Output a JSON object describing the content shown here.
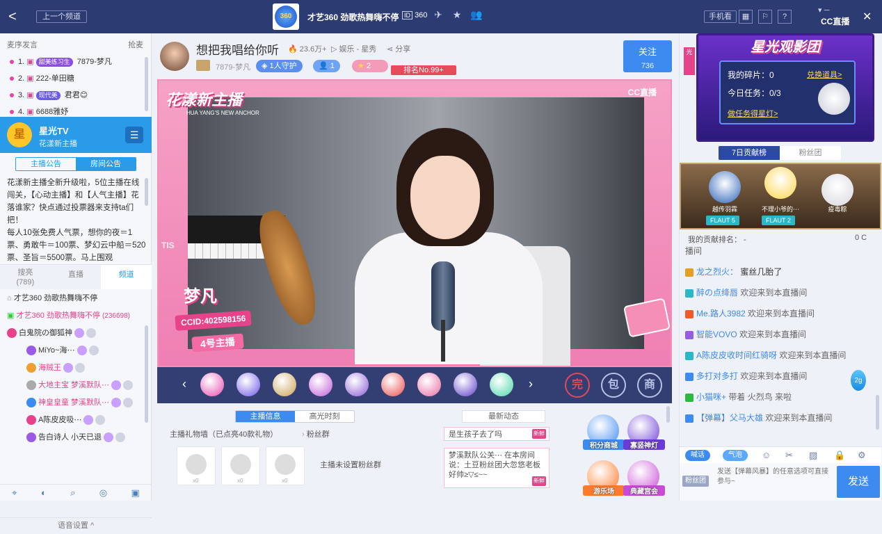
{
  "topbar": {
    "back": "<",
    "prev_channel": "上一个频道",
    "channel_logo": "360",
    "channel_title": "才艺360 劲歌热舞嗨不停",
    "channel_id_icon": "ID",
    "channel_id": "360",
    "phone_watch": "手机看",
    "cc_brand": "CC直播",
    "close": "✕"
  },
  "left": {
    "queue_header": "麦序发言",
    "grab_mic": "抢麦",
    "queue": [
      {
        "rank": "1.",
        "level": "甜美练习生",
        "level_color": "#8a4de6",
        "name": "7879-梦凡"
      },
      {
        "rank": "2.",
        "level": "",
        "level_color": "",
        "name": "222-单田糖"
      },
      {
        "rank": "3.",
        "level": "现代美",
        "level_color": "#6a5ae8",
        "name": "君君😊"
      },
      {
        "rank": "4.",
        "level": "",
        "level_color": "",
        "name": "6688雅妤"
      }
    ],
    "star_tv": {
      "icon": "星",
      "name": "星光TV",
      "sub": "花漾新主播"
    },
    "tabs": [
      "主播公告",
      "房间公告"
    ],
    "notice": "花漾新主播全新升级啦，5位主播在线闯关，【心动主播】和【人气主播】花落谁家？快点通过投票器来支持ta们把！\n每人10张免费人气票，想你的夜＝1票、勇敢牛＝100票、梦幻云中船＝520票、圣旨＝5500票。马上围观",
    "subtabs": [
      {
        "label": "搜亮",
        "count": "(789)"
      },
      {
        "label": "直播",
        "count": ""
      },
      {
        "label": "频道",
        "count": ""
      }
    ],
    "channel_rows": [
      {
        "text": "才艺360  劲歌热舞嗨不停",
        "color": "#333",
        "extra": ""
      },
      {
        "text": "才艺360  劲歌热舞嗨不停",
        "color": "#e6438a",
        "extra": "(236698)"
      },
      {
        "text": "白鬼院の御狐神",
        "color": "#333",
        "extra": ""
      },
      {
        "text": "MiYo~海⋯",
        "color": "#333",
        "extra": ""
      },
      {
        "text": "海贼王",
        "color": "#e6438a",
        "extra": ""
      },
      {
        "text": "大地主宝  梦溪默队⋯",
        "color": "#e6438a",
        "extra": ""
      },
      {
        "text": "神皇皇童  梦溪默队⋯",
        "color": "#e6438a",
        "extra": ""
      },
      {
        "text": "A陈皮皮吸⋯",
        "color": "#333",
        "extra": ""
      },
      {
        "text": "告白诗人  小天已退",
        "color": "#333",
        "extra": ""
      }
    ],
    "voice_setting": "语音设置 ^"
  },
  "room": {
    "title": "想把我唱给你听",
    "hot": "23.6万+",
    "category": "娱乐 - 星秀",
    "share": "分享",
    "streamer_id": "7879-梦凡",
    "guard": "1人守护",
    "fans": "1",
    "stars": "2",
    "rank_no": "排名No.99+",
    "follow_label": "关注",
    "follow_count": "736"
  },
  "video": {
    "logo_text": "花漾新主播",
    "logo_sub": "HUA YANG'S NEW ANCHOR",
    "cc_mark": "CC直播",
    "streamer_name": "梦凡",
    "ccid": "CCID:402598156",
    "host_no": "4号主播",
    "side_tag": "TIS"
  },
  "gifts": {
    "prev": "‹",
    "next": "›",
    "items": [
      {
        "color": "#e64bb0"
      },
      {
        "color": "#6b55e6"
      },
      {
        "color": "#c9a050"
      },
      {
        "color": "#c05bd6"
      },
      {
        "color": "#8a58d6"
      },
      {
        "color": "#e84b4b"
      },
      {
        "color": "#e66aa2"
      },
      {
        "color": "#5a3cc9"
      },
      {
        "color": "#4ad6a8"
      }
    ],
    "btn_complete": "完",
    "btn_bag": "包",
    "btn_shop": "商"
  },
  "bottom": {
    "tabs": [
      "主播信息",
      "高光时刻"
    ],
    "gift_wall": "主播礼物墙（已点亮40款礼物）",
    "fan_group": "粉丝群",
    "no_fan_group": "主播未设置粉丝群",
    "latest": "最新动态",
    "news": [
      {
        "text": "是生孩子去了吗",
        "tag": "新鲜"
      },
      {
        "text": "梦溪默队公关⋯  在本房间说：土豆粉丝团大忽悠老板好帅≥▽≤~~",
        "tag": "新鲜"
      }
    ],
    "mall": [
      {
        "label": "积分商城",
        "color": "#3d8af0"
      },
      {
        "label": "寡竖神灯",
        "color": "#6b3bd6"
      },
      {
        "label": "游乐场",
        "color": "#ff7a2a"
      },
      {
        "label": "典藏宫会",
        "color": "#c84ad6"
      }
    ],
    "wall_slots": [
      "x0",
      "x0",
      "x0"
    ]
  },
  "right": {
    "promo": {
      "title": "星光观影团",
      "fragments": "我的碎片：0",
      "redeem": "兑换道具>",
      "task": "今日任务：0/3",
      "do_task": "做任务得星灯>"
    },
    "tabs": [
      "7日贡献榜",
      "粉丝团"
    ],
    "podium": [
      {
        "name": "越传羽霖",
        "ff": "FLAUT 5",
        "color": "#2a62b8"
      },
      {
        "name": "不理小爷的⋯",
        "ff": "FLAUT 2",
        "color": "#ffd54a"
      },
      {
        "name": "疫毒粽",
        "ff": "",
        "color": "#d8d8e0"
      }
    ],
    "my_rank_label": "我的贡献排名：  -",
    "my_rank_value": "0 C",
    "chat": [
      {
        "user": "",
        "msg": "播间",
        "color": "#666"
      },
      {
        "user": "龙之烈火：",
        "msg": "蜜丝几胎了",
        "color": "#333"
      },
      {
        "user": "醉の点绛唇",
        "msg": "欢迎来到本直播间",
        "color": "#666"
      },
      {
        "user": "Me.路人3982",
        "msg": "欢迎来到本直播间",
        "color": "#666"
      },
      {
        "user": "智能VOVO",
        "msg": "欢迎来到本直播间",
        "color": "#666"
      },
      {
        "user": "A陈皮皮收时间红骑呀",
        "msg": "欢迎来到本直播间",
        "color": "#666"
      },
      {
        "user": "多打对多打",
        "msg": "欢迎来到本直播间",
        "color": "#666"
      },
      {
        "user": "小猫咪+",
        "msg": "带着  火烈鸟  来啦",
        "color": "#666"
      },
      {
        "user": "【弹幕】父马大雄",
        "msg": "欢迎来到本直播间",
        "color": "#666"
      }
    ],
    "drop_label": "2g",
    "tools": [
      "喊话",
      "气泡"
    ],
    "fan_btn": "粉丝团",
    "input_placeholder": "发送【弹幕风暴】的任意选项可直接参与~",
    "send": "发送"
  }
}
